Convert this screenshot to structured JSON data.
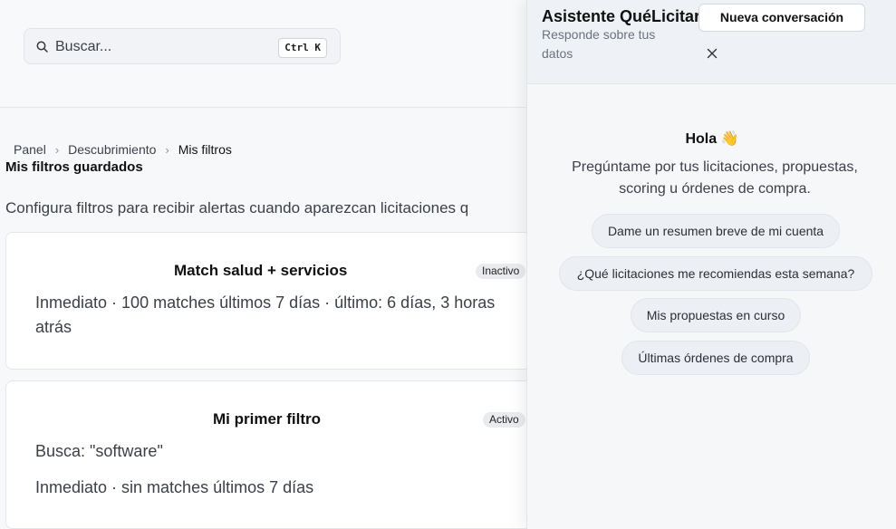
{
  "search": {
    "placeholder": "Buscar...",
    "shortcut": "Ctrl K"
  },
  "breadcrumb": {
    "items": [
      "Panel",
      "Descubrimiento",
      "Mis filtros"
    ]
  },
  "page": {
    "title": "Mis filtros guardados",
    "description": "Configura filtros para recibir alertas cuando aparezcan licitaciones q"
  },
  "filters": [
    {
      "name": "Match salud + servicios",
      "status": "Inactivo",
      "summary_line1": "Inmediato · 100 matches últimos 7 días · último: 6 días, 3 horas",
      "summary_line2": "atrás"
    },
    {
      "name": "Mi primer filtro",
      "status": "Activo",
      "query": "Busca: \"software\"",
      "summary": "Inmediato · sin matches últimos 7 días"
    }
  ],
  "assistant": {
    "title": "Asistente QuéLicitar",
    "subtitle": "Responde sobre tus datos",
    "new_conversation": "Nueva conversación",
    "greeting": "Hola 👋",
    "intro": "Pregúntame por tus licitaciones, propuestas, scoring u órdenes de compra.",
    "suggestions": [
      "Dame un resumen breve de mi cuenta",
      "¿Qué licitaciones me recomiendas esta semana?",
      "Mis propuestas en curso",
      "Últimas órdenes de compra"
    ]
  }
}
